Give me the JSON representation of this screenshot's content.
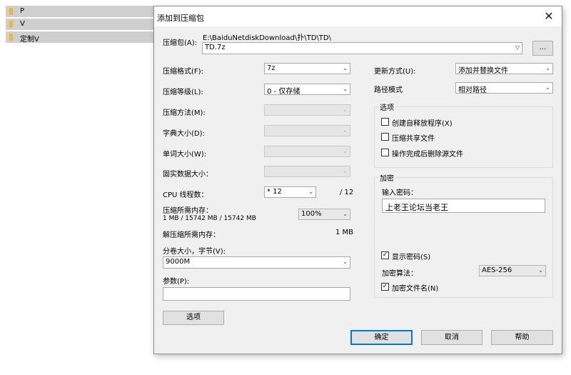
{
  "explorer": {
    "items": [
      {
        "name": "P"
      },
      {
        "name": "V"
      },
      {
        "name": "定制V"
      }
    ]
  },
  "dialog": {
    "title": "添加到压缩包",
    "archive": {
      "label": "压缩包(A):",
      "path": "E:\\BaiduNetdiskDownload\\扑\\TD\\TD\\",
      "filename": "TD.7z",
      "browse_label": "..."
    },
    "format": {
      "label": "压缩格式(F):",
      "value": "7z"
    },
    "level": {
      "label": "压缩等级(L):",
      "value": "0 - 仅存储"
    },
    "method": {
      "label": "压缩方法(M):",
      "value": ""
    },
    "dict_size": {
      "label": "字典大小(D):",
      "value": ""
    },
    "word_size": {
      "label": "单词大小(W):",
      "value": ""
    },
    "solid_size": {
      "label": "固实数据大小：",
      "value": ""
    },
    "cpu": {
      "label": "CPU 线程数：",
      "value": "* 12",
      "total": "/ 12"
    },
    "memory": {
      "label": "压缩所需内存：",
      "detail": "1 MB / 15742 MB / 15742 MB",
      "percent": "100%"
    },
    "decompress_memory": {
      "label": "解压缩所需内存：",
      "value": "1 MB"
    },
    "volume": {
      "label": "分卷大小，字节(V):",
      "value": "9000M"
    },
    "params": {
      "label": "参数(P):",
      "value": ""
    },
    "options_button": "选项",
    "update_mode": {
      "label": "更新方式(U):",
      "value": "添加并替换文件"
    },
    "path_mode": {
      "label": "路径模式",
      "value": "相对路径"
    },
    "options_group": {
      "title": "选项",
      "sfx": "创建自释放程序(X)",
      "shared": "压缩共享文件",
      "delete_after": "操作完成后删除源文件"
    },
    "encryption": {
      "title": "加密",
      "password_label": "输入密码：",
      "password": "上老王论坛当老王",
      "show_password": "显示密码(S)",
      "method_label": "加密算法：",
      "method": "AES-256",
      "encrypt_names": "加密文件名(N)"
    },
    "buttons": {
      "ok": "确定",
      "cancel": "取消",
      "help": "帮助"
    }
  }
}
